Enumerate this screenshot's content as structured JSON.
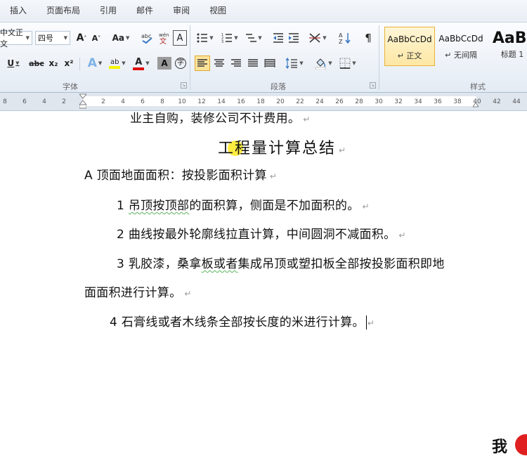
{
  "menu": {
    "tabs": [
      "插入",
      "页面布局",
      "引用",
      "邮件",
      "审阅",
      "视图"
    ]
  },
  "ribbon": {
    "font": {
      "group_label": "字体",
      "font_name": "中文正文",
      "font_size": "四号",
      "grow_font": "A",
      "shrink_font": "A",
      "change_case": "Aa",
      "clear_format": "A",
      "underline": "U",
      "strikethrough": "abc",
      "subscript": "x₂",
      "superscript": "x²",
      "text_effect": "A",
      "highlight": "ab",
      "font_color": "A",
      "char_shading": "A",
      "enclose_char": "字"
    },
    "paragraph": {
      "group_label": "段落"
    },
    "styles": {
      "group_label": "样式",
      "items": [
        {
          "preview": "AaBbCcDd",
          "name": "↵ 正文"
        },
        {
          "preview": "AaBbCcDd",
          "name": "↵ 无间隔"
        },
        {
          "preview": "AaBl",
          "name": "标题 1"
        }
      ]
    }
  },
  "ruler": {
    "left_labels": [
      "8",
      "6",
      "4",
      "2"
    ],
    "right_labels": [
      "2",
      "4",
      "6",
      "8",
      "10",
      "12",
      "14",
      "16",
      "18",
      "20",
      "22",
      "24",
      "26",
      "28",
      "30",
      "32",
      "34",
      "36",
      "38",
      "40",
      "42",
      "44"
    ]
  },
  "document": {
    "line0": "业主自购，装修公司不计费用。",
    "title": "工程量计算总结",
    "heading_a": "A 顶面地面面积：按投影面积计算",
    "item1_num": "1 ",
    "item1_p1": "吊顶按顶部",
    "item1_p2": "的面积算，侧面是不加面积的。",
    "item2": "2 曲线按最外轮廓线拉直计算，中间圆洞不减面积。",
    "item3_p1": "3 乳胶漆，桑拿",
    "item3_p2": "板或者",
    "item3_p3": "集成吊顶或塑扣板全部按投影面积即地",
    "item3_cont": "面面积进行计算。",
    "item4": "4 石膏线或者木线条全部按长度的米进行计算。",
    "para_mark": "↵"
  },
  "watermark": {
    "text": "我"
  }
}
